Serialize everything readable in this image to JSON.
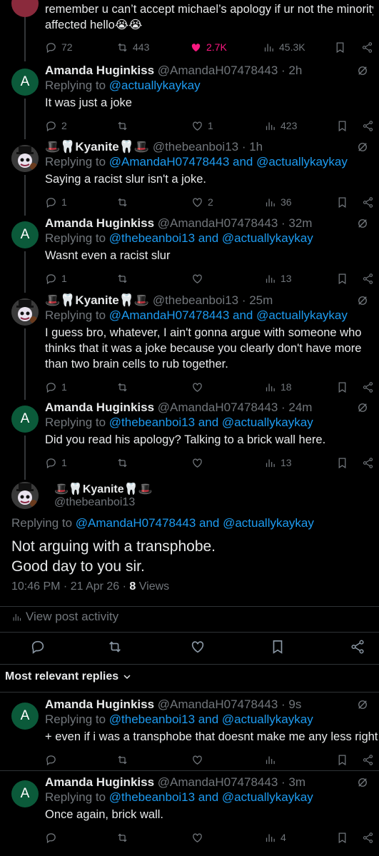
{
  "top_tweet": {
    "text_line1": "remember u can’t accept michael’s apology if ur not the minority",
    "text_line2": "affected hello😭😭",
    "replies": "72",
    "reposts": "443",
    "likes": "2.7K",
    "views": "45.3K"
  },
  "replies": [
    {
      "name": "Amanda Huginkiss",
      "handle": "@AmandaH07478443 · 2h",
      "replying_prefix": "Replying to ",
      "replying_to": "@actuallykaykay",
      "lines": [
        "It was just a joke"
      ],
      "counts": {
        "replies": "2",
        "reposts": "",
        "likes": "1",
        "views": "423"
      }
    },
    {
      "name": "🎩🦷Kyanite🦷🎩",
      "handle": "@thebeanboi13 · 1h",
      "replying_prefix": "Replying to ",
      "replying_to": "@AmandaH07478443 and @actuallykaykay",
      "lines": [
        "Saying a racist slur isn't a joke."
      ],
      "counts": {
        "replies": "1",
        "reposts": "",
        "likes": "2",
        "views": "36"
      }
    },
    {
      "name": "Amanda Huginkiss",
      "handle": "@AmandaH07478443 · 32m",
      "replying_prefix": "Replying to ",
      "replying_to": "@thebeanboi13 and @actuallykaykay",
      "lines": [
        "Wasnt even a racist slur"
      ],
      "counts": {
        "replies": "1",
        "reposts": "",
        "likes": "",
        "views": "13"
      }
    },
    {
      "name": "🎩🦷Kyanite🦷🎩",
      "handle": "@thebeanboi13 · 25m",
      "replying_prefix": "Replying to ",
      "replying_to": "@AmandaH07478443 and @actuallykaykay",
      "lines": [
        "I guess bro, whatever, I ain't gonna argue with someone who",
        "thinks that it was a joke because you clearly don't have more",
        "than two brain cells to rub together."
      ],
      "counts": {
        "replies": "1",
        "reposts": "",
        "likes": "",
        "views": "18"
      }
    },
    {
      "name": "Amanda Huginkiss",
      "handle": "@AmandaH07478443 · 24m",
      "replying_prefix": "Replying to ",
      "replying_to": "@thebeanboi13 and @actuallykaykay",
      "lines": [
        "Did you read his apology? Talking to a brick wall here."
      ],
      "counts": {
        "replies": "1",
        "reposts": "",
        "likes": "",
        "views": "13"
      }
    }
  ],
  "main_post": {
    "name": "🎩🦷Kyanite🦷🎩",
    "handle": "@thebeanboi13",
    "replying_prefix": "Replying to ",
    "replying_to": "@AmandaH07478443 and @actuallykaykay",
    "line1": "Not arguing with a transphobe.",
    "line2": "Good day to you sir.",
    "timestamp": "10:46 PM · 21 Apr 26 · ",
    "views_count": "8",
    "views_label": " Views",
    "activity": "View post activity"
  },
  "sort_label": "Most relevant replies",
  "bottom_replies": [
    {
      "name": "Amanda Huginkiss",
      "handle": "@AmandaH07478443 · 9s",
      "replying_prefix": "Replying to ",
      "replying_to": "@thebeanboi13 and @actuallykaykay",
      "lines": [
        "+ even if i was a transphobe that doesnt make me any less right"
      ],
      "counts": {
        "replies": "",
        "reposts": "",
        "likes": "",
        "views": ""
      }
    },
    {
      "name": "Amanda Huginkiss",
      "handle": "@AmandaH07478443 · 3m",
      "replying_prefix": "Replying to ",
      "replying_to": "@thebeanboi13 and @actuallykaykay",
      "lines": [
        "Once again, brick wall."
      ],
      "counts": {
        "replies": "",
        "reposts": "",
        "likes": "",
        "views": "4"
      }
    }
  ],
  "avatar_letter": "A",
  "colors": {
    "link": "#1d9bf0",
    "like_active": "#f91880",
    "muted": "#71767b",
    "avatar_green": "#0b5a3a"
  }
}
